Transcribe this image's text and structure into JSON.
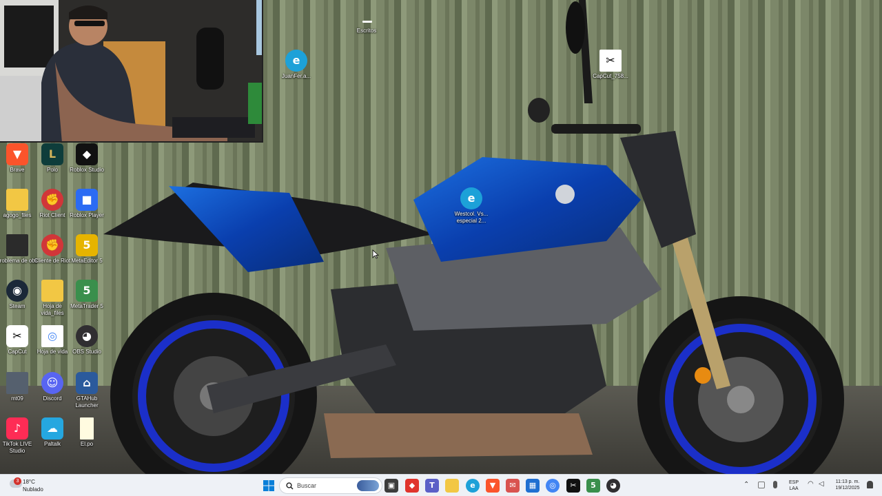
{
  "desktop": {
    "icons": [
      {
        "label": "Brave",
        "icon": "brave-icon",
        "color": "#fb542b"
      },
      {
        "label": "Polo",
        "icon": "league-icon",
        "color": "#0e3d3b"
      },
      {
        "label": "Roblox Studio",
        "icon": "roblox-studio-icon",
        "color": "#111111"
      },
      {
        "label": "agogo_files",
        "icon": "folder-icon",
        "color": "#f2c744"
      },
      {
        "label": "Riot Client",
        "icon": "riot-icon",
        "color": "#d13639"
      },
      {
        "label": "Roblox Player",
        "icon": "roblox-icon",
        "color": "#2b6bf3"
      },
      {
        "label": "problema de obs",
        "icon": "file-icon",
        "color": "#333333"
      },
      {
        "label": "Cliente de Riot",
        "icon": "riot-icon",
        "color": "#d13639"
      },
      {
        "label": "MetaEditor 5",
        "icon": "metaeditor-icon",
        "color": "#e6b400"
      },
      {
        "label": "Steam",
        "icon": "steam-icon",
        "color": "#1b2838"
      },
      {
        "label": "Hoja de vida_files",
        "icon": "folder-icon",
        "color": "#f2c744"
      },
      {
        "label": "MetaTrader 5",
        "icon": "metatrader-icon",
        "color": "#3a8f4c"
      },
      {
        "label": "CapCut",
        "icon": "capcut-icon",
        "color": "#000000"
      },
      {
        "label": "Hoja de vida",
        "icon": "chrome-icon",
        "color": "#ffffff"
      },
      {
        "label": "OBS Studio",
        "icon": "obs-icon",
        "color": "#302e31"
      },
      {
        "label": "mt09",
        "icon": "image-file-icon",
        "color": "#55606e"
      },
      {
        "label": "Discord",
        "icon": "discord-icon",
        "color": "#5865f2"
      },
      {
        "label": "GTAHub Launcher",
        "icon": "gtahub-icon",
        "color": "#2b5a9c"
      },
      {
        "label": "TikTok LIVE Studio",
        "icon": "tiktok-icon",
        "color": "#fe2c55"
      },
      {
        "label": "Paltalk",
        "icon": "paltalk-icon",
        "color": "#25a7e0"
      },
      {
        "label": "El.po",
        "icon": "text-file-icon",
        "color": "#fffbe0"
      },
      {
        "label": "Escritos",
        "icon": "text-file-icon",
        "color": "#ffffff"
      },
      {
        "label": "JuanFer.a...",
        "icon": "edge-icon",
        "color": "#1da1d8"
      },
      {
        "label": "CapCut_758...",
        "icon": "capcut-icon",
        "color": "#ffffff"
      },
      {
        "label": "Westcol. Vs... especial 2...",
        "icon": "edge-icon",
        "color": "#1da1d8"
      }
    ]
  },
  "taskbar": {
    "search_placeholder": "Buscar",
    "weather_temp": "18°C",
    "weather_desc": "Nublado",
    "weather_badge": "3",
    "language_line1": "ESP",
    "language_line2": "LAA",
    "clock_time": "11:13 p. m.",
    "clock_date": "19/12/2025",
    "apps": [
      {
        "icon": "start-icon",
        "color": "#0078d4"
      },
      {
        "icon": "search-icon",
        "color": "#444444"
      },
      {
        "icon": "task-view-icon",
        "color": "#333333"
      },
      {
        "icon": "anydesk-icon",
        "color": "#e0342c"
      },
      {
        "icon": "teams-icon",
        "color": "#5b5fc7"
      },
      {
        "icon": "file-explorer-icon",
        "color": "#f2c744"
      },
      {
        "icon": "edge-icon",
        "color": "#1da1d8"
      },
      {
        "icon": "brave-icon",
        "color": "#fb542b"
      },
      {
        "icon": "mail-icon",
        "color": "#d9534f"
      },
      {
        "icon": "store-icon",
        "color": "#1f6fd1"
      },
      {
        "icon": "chrome-icon",
        "color": "#4285f4"
      },
      {
        "icon": "capcut-icon",
        "color": "#111111"
      },
      {
        "icon": "metatrader-icon",
        "color": "#3a8f4c"
      },
      {
        "icon": "obs-icon",
        "color": "#302e31"
      }
    ]
  }
}
